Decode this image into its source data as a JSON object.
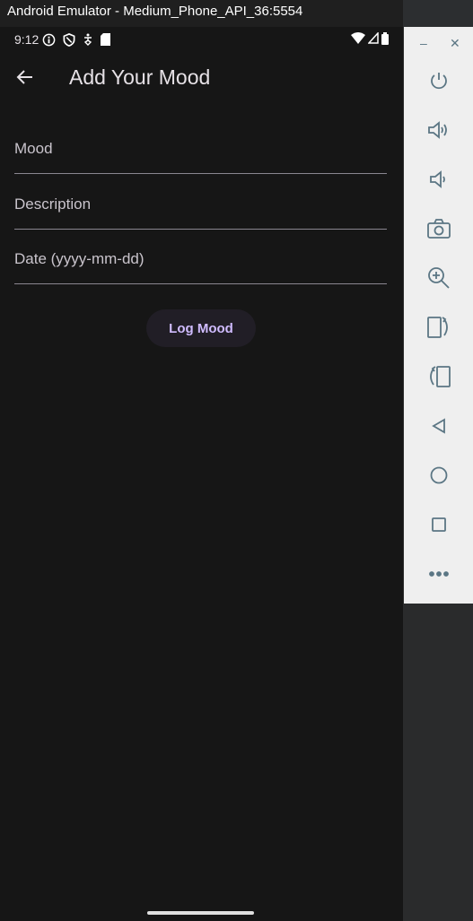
{
  "window": {
    "title": "Android Emulator - Medium_Phone_API_36:5554"
  },
  "status_bar": {
    "time": "9:12"
  },
  "app_bar": {
    "title": "Add Your Mood"
  },
  "form": {
    "fields": [
      {
        "label": "Mood",
        "value": ""
      },
      {
        "label": "Description",
        "value": ""
      },
      {
        "label": "Date (yyyy-mm-dd)",
        "value": ""
      }
    ],
    "submit_label": "Log Mood"
  },
  "colors": {
    "background": "#161616",
    "accent": "#d0bcff",
    "button_bg": "#211e26"
  },
  "side_panel": {
    "icons": [
      "power-icon",
      "volume-up-icon",
      "volume-down-icon",
      "camera-icon",
      "zoom-icon",
      "rotate-left-icon",
      "rotate-right-icon",
      "back-icon",
      "home-icon",
      "overview-icon",
      "more-icon"
    ]
  }
}
